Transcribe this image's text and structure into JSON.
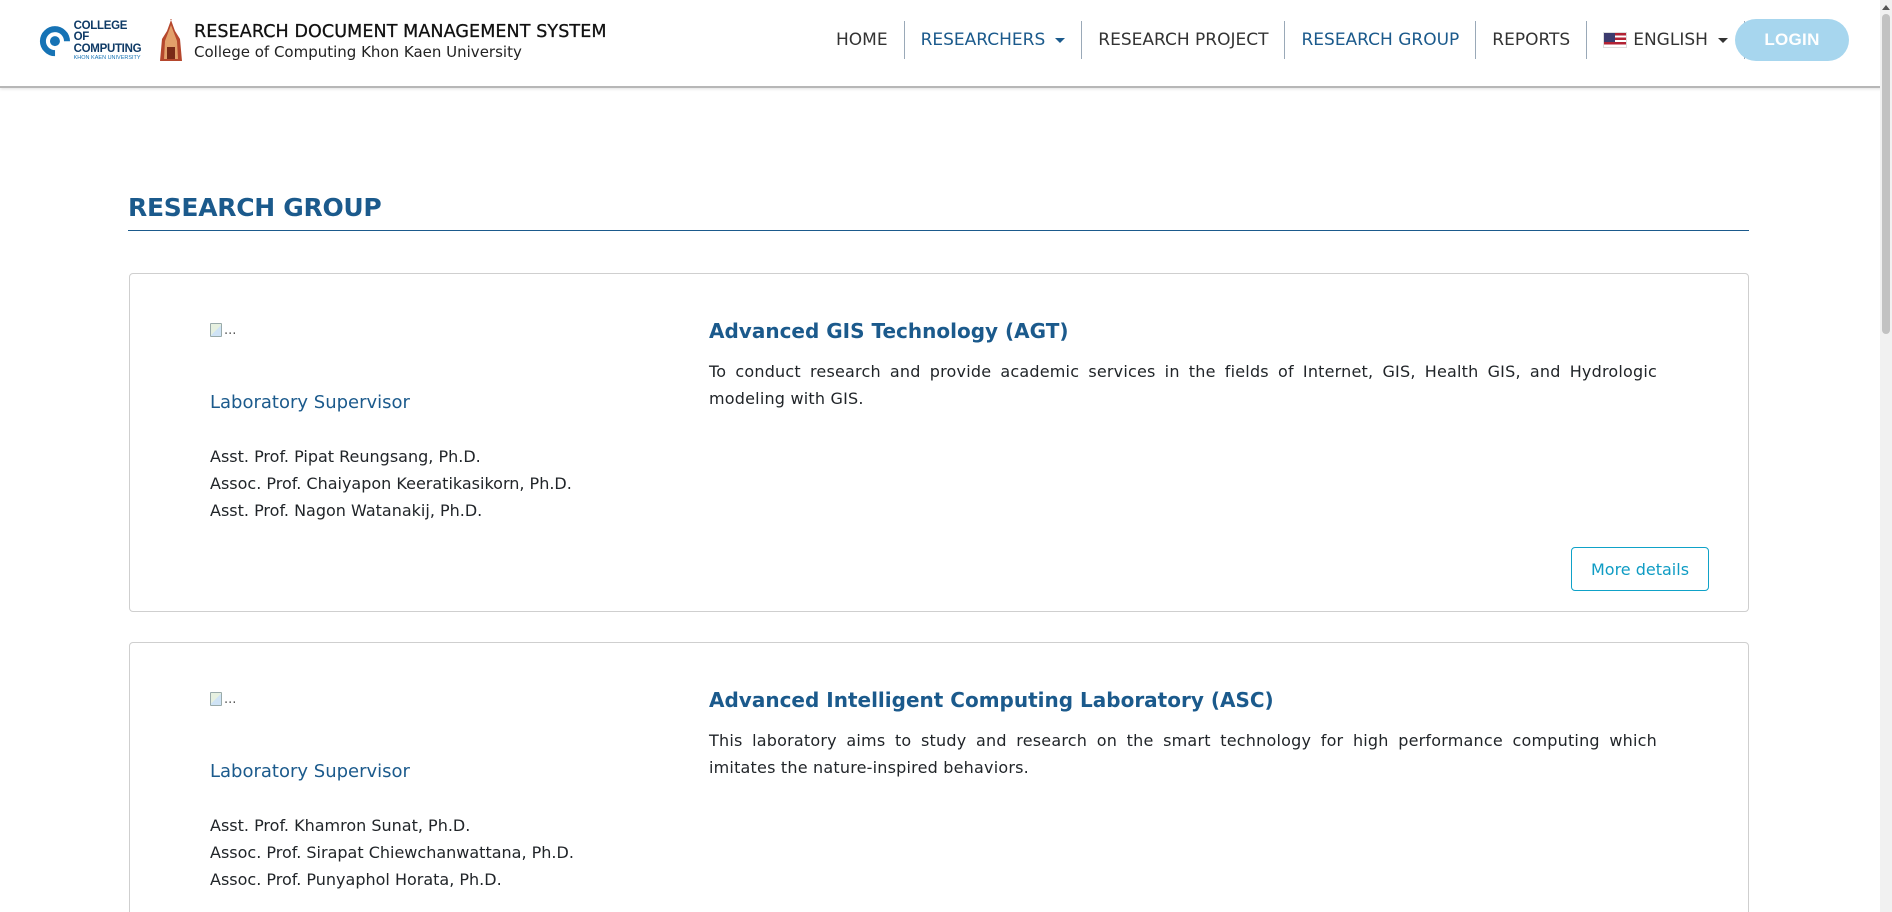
{
  "brand": {
    "college_line1": "COLLEGE OF",
    "college_line2": "COMPUTING",
    "college_line3": "KHON KAEN UNIVERSITY",
    "title": "RESEARCH DOCUMENT MANAGEMENT SYSTEM",
    "subtitle": "College of Computing Khon Kaen University"
  },
  "nav": {
    "items": [
      {
        "label": "HOME"
      },
      {
        "label": "RESEARCHERS"
      },
      {
        "label": "RESEARCH PROJECT"
      },
      {
        "label": "RESEARCH GROUP"
      },
      {
        "label": "REPORTS"
      },
      {
        "label": "ENGLISH"
      }
    ],
    "login": "LOGIN"
  },
  "page": {
    "title": "RESEARCH GROUP"
  },
  "groups": [
    {
      "image_alt": "...",
      "supervisor_label": "Laboratory Supervisor",
      "members": [
        "Asst. Prof. Pipat Reungsang, Ph.D.",
        "Assoc. Prof. Chaiyapon Keeratikasikorn, Ph.D.",
        "Asst. Prof. Nagon Watanakij, Ph.D."
      ],
      "name": "Advanced GIS Technology (AGT)",
      "description": "To conduct research and provide academic services in the fields of Internet, GIS, Health GIS, and Hydrologic modeling with GIS.",
      "more_label": "More details"
    },
    {
      "image_alt": "...",
      "supervisor_label": "Laboratory Supervisor",
      "members": [
        "Asst. Prof. Khamron Sunat, Ph.D.",
        "Assoc. Prof. Sirapat Chiewchanwattana, Ph.D.",
        "Assoc. Prof. Punyaphol Horata, Ph.D."
      ],
      "name": "Advanced Intelligent Computing Laboratory (ASC)",
      "description": "This laboratory aims to study and research on the smart technology for high performance computing which imitates the nature-inspired behaviors."
    }
  ],
  "colors": {
    "primary": "#1b5a8c",
    "login_bg": "#a7d6ee",
    "more_border": "#0fa2c8"
  }
}
